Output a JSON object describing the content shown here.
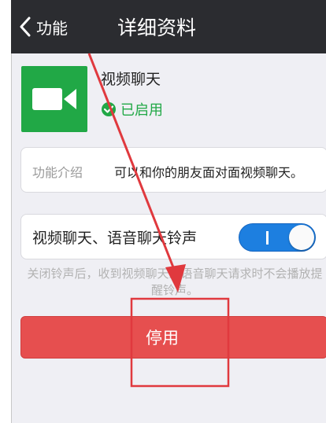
{
  "nav": {
    "back_label": "功能",
    "title": "详细资料"
  },
  "app": {
    "name": "视频聊天",
    "status": "已启用",
    "icon": "video-camera-icon",
    "icon_color": "#21a846"
  },
  "intro": {
    "label": "功能介绍",
    "text": "可以和你的朋友面对面视频聊天。"
  },
  "ringtone": {
    "label": "视频聊天、语音聊天铃声",
    "toggle_on": true,
    "note": "关闭铃声后，收到视频聊天或语音聊天请求时不会播放提醒铃声。"
  },
  "actions": {
    "stop_label": "停用",
    "stop_color": "#e64f4f"
  },
  "annotation": {
    "color": "#e0393e"
  }
}
